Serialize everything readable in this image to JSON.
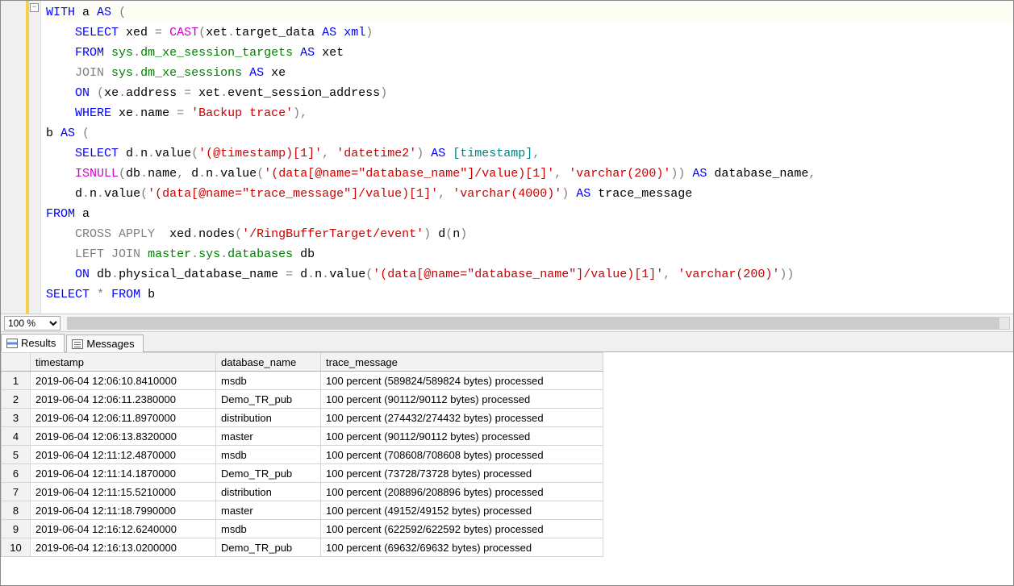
{
  "editor": {
    "fold_icon": "−",
    "code_lines": [
      [
        {
          "t": "WITH",
          "c": "kw-blue"
        },
        {
          "t": " a ",
          "c": "plain"
        },
        {
          "t": "AS",
          "c": "kw-blue"
        },
        {
          "t": " ",
          "c": "plain"
        },
        {
          "t": "(",
          "c": "kw-gray"
        }
      ],
      [
        {
          "t": "    ",
          "c": "plain"
        },
        {
          "t": "SELECT",
          "c": "kw-blue"
        },
        {
          "t": " xed ",
          "c": "plain"
        },
        {
          "t": "=",
          "c": "kw-gray"
        },
        {
          "t": " ",
          "c": "plain"
        },
        {
          "t": "CAST",
          "c": "kw-mag"
        },
        {
          "t": "(",
          "c": "kw-gray"
        },
        {
          "t": "xet",
          "c": "plain"
        },
        {
          "t": ".",
          "c": "kw-gray"
        },
        {
          "t": "target_data ",
          "c": "plain"
        },
        {
          "t": "AS",
          "c": "kw-blue"
        },
        {
          "t": " ",
          "c": "plain"
        },
        {
          "t": "xml",
          "c": "kw-blue"
        },
        {
          "t": ")",
          "c": "kw-gray"
        }
      ],
      [
        {
          "t": "    ",
          "c": "plain"
        },
        {
          "t": "FROM",
          "c": "kw-blue"
        },
        {
          "t": " ",
          "c": "plain"
        },
        {
          "t": "sys",
          "c": "kw-green"
        },
        {
          "t": ".",
          "c": "kw-gray"
        },
        {
          "t": "dm_xe_session_targets",
          "c": "kw-green"
        },
        {
          "t": " ",
          "c": "plain"
        },
        {
          "t": "AS",
          "c": "kw-blue"
        },
        {
          "t": " xet",
          "c": "plain"
        }
      ],
      [
        {
          "t": "    ",
          "c": "plain"
        },
        {
          "t": "JOIN",
          "c": "kw-gray"
        },
        {
          "t": " ",
          "c": "plain"
        },
        {
          "t": "sys",
          "c": "kw-green"
        },
        {
          "t": ".",
          "c": "kw-gray"
        },
        {
          "t": "dm_xe_sessions",
          "c": "kw-green"
        },
        {
          "t": " ",
          "c": "plain"
        },
        {
          "t": "AS",
          "c": "kw-blue"
        },
        {
          "t": " xe",
          "c": "plain"
        }
      ],
      [
        {
          "t": "    ",
          "c": "plain"
        },
        {
          "t": "ON",
          "c": "kw-blue"
        },
        {
          "t": " ",
          "c": "plain"
        },
        {
          "t": "(",
          "c": "kw-gray"
        },
        {
          "t": "xe",
          "c": "plain"
        },
        {
          "t": ".",
          "c": "kw-gray"
        },
        {
          "t": "address ",
          "c": "plain"
        },
        {
          "t": "=",
          "c": "kw-gray"
        },
        {
          "t": " xet",
          "c": "plain"
        },
        {
          "t": ".",
          "c": "kw-gray"
        },
        {
          "t": "event_session_address",
          "c": "plain"
        },
        {
          "t": ")",
          "c": "kw-gray"
        }
      ],
      [
        {
          "t": "    ",
          "c": "plain"
        },
        {
          "t": "WHERE",
          "c": "kw-blue"
        },
        {
          "t": " xe",
          "c": "plain"
        },
        {
          "t": ".",
          "c": "kw-gray"
        },
        {
          "t": "name ",
          "c": "plain"
        },
        {
          "t": "=",
          "c": "kw-gray"
        },
        {
          "t": " ",
          "c": "plain"
        },
        {
          "t": "'Backup trace'",
          "c": "kw-str"
        },
        {
          "t": "),",
          "c": "kw-gray"
        }
      ],
      [
        {
          "t": "b ",
          "c": "plain"
        },
        {
          "t": "AS",
          "c": "kw-blue"
        },
        {
          "t": " ",
          "c": "plain"
        },
        {
          "t": "(",
          "c": "kw-gray"
        }
      ],
      [
        {
          "t": "    ",
          "c": "plain"
        },
        {
          "t": "SELECT",
          "c": "kw-blue"
        },
        {
          "t": " d",
          "c": "plain"
        },
        {
          "t": ".",
          "c": "kw-gray"
        },
        {
          "t": "n",
          "c": "plain"
        },
        {
          "t": ".",
          "c": "kw-gray"
        },
        {
          "t": "value",
          "c": "plain"
        },
        {
          "t": "(",
          "c": "kw-gray"
        },
        {
          "t": "'(@timestamp)[1]'",
          "c": "kw-str"
        },
        {
          "t": ",",
          "c": "kw-gray"
        },
        {
          "t": " ",
          "c": "plain"
        },
        {
          "t": "'datetime2'",
          "c": "kw-str"
        },
        {
          "t": ")",
          "c": "kw-gray"
        },
        {
          "t": " ",
          "c": "plain"
        },
        {
          "t": "AS",
          "c": "kw-blue"
        },
        {
          "t": " ",
          "c": "plain"
        },
        {
          "t": "[timestamp]",
          "c": "kw-teal"
        },
        {
          "t": ",",
          "c": "kw-gray"
        }
      ],
      [
        {
          "t": "    ",
          "c": "plain"
        },
        {
          "t": "ISNULL",
          "c": "kw-mag"
        },
        {
          "t": "(",
          "c": "kw-gray"
        },
        {
          "t": "db",
          "c": "plain"
        },
        {
          "t": ".",
          "c": "kw-gray"
        },
        {
          "t": "name",
          "c": "plain"
        },
        {
          "t": ",",
          "c": "kw-gray"
        },
        {
          "t": " d",
          "c": "plain"
        },
        {
          "t": ".",
          "c": "kw-gray"
        },
        {
          "t": "n",
          "c": "plain"
        },
        {
          "t": ".",
          "c": "kw-gray"
        },
        {
          "t": "value",
          "c": "plain"
        },
        {
          "t": "(",
          "c": "kw-gray"
        },
        {
          "t": "'(data[@name=\"database_name\"]/value)[1]'",
          "c": "kw-str"
        },
        {
          "t": ",",
          "c": "kw-gray"
        },
        {
          "t": " ",
          "c": "plain"
        },
        {
          "t": "'varchar(200)'",
          "c": "kw-str"
        },
        {
          "t": "))",
          "c": "kw-gray"
        },
        {
          "t": " ",
          "c": "plain"
        },
        {
          "t": "AS",
          "c": "kw-blue"
        },
        {
          "t": " database_name",
          "c": "plain"
        },
        {
          "t": ",",
          "c": "kw-gray"
        }
      ],
      [
        {
          "t": "    d",
          "c": "plain"
        },
        {
          "t": ".",
          "c": "kw-gray"
        },
        {
          "t": "n",
          "c": "plain"
        },
        {
          "t": ".",
          "c": "kw-gray"
        },
        {
          "t": "value",
          "c": "plain"
        },
        {
          "t": "(",
          "c": "kw-gray"
        },
        {
          "t": "'(data[@name=\"trace_message\"]/value)[1]'",
          "c": "kw-str"
        },
        {
          "t": ",",
          "c": "kw-gray"
        },
        {
          "t": " ",
          "c": "plain"
        },
        {
          "t": "'varchar(4000)'",
          "c": "kw-str"
        },
        {
          "t": ")",
          "c": "kw-gray"
        },
        {
          "t": " ",
          "c": "plain"
        },
        {
          "t": "AS",
          "c": "kw-blue"
        },
        {
          "t": " trace_message",
          "c": "plain"
        }
      ],
      [
        {
          "t": "FROM",
          "c": "kw-blue"
        },
        {
          "t": " a",
          "c": "plain"
        }
      ],
      [
        {
          "t": "    ",
          "c": "plain"
        },
        {
          "t": "CROSS",
          "c": "kw-gray"
        },
        {
          "t": " ",
          "c": "plain"
        },
        {
          "t": "APPLY",
          "c": "kw-gray"
        },
        {
          "t": "  xed",
          "c": "plain"
        },
        {
          "t": ".",
          "c": "kw-gray"
        },
        {
          "t": "nodes",
          "c": "plain"
        },
        {
          "t": "(",
          "c": "kw-gray"
        },
        {
          "t": "'/RingBufferTarget/event'",
          "c": "kw-str"
        },
        {
          "t": ")",
          "c": "kw-gray"
        },
        {
          "t": " d",
          "c": "plain"
        },
        {
          "t": "(",
          "c": "kw-gray"
        },
        {
          "t": "n",
          "c": "plain"
        },
        {
          "t": ")",
          "c": "kw-gray"
        }
      ],
      [
        {
          "t": "    ",
          "c": "plain"
        },
        {
          "t": "LEFT",
          "c": "kw-gray"
        },
        {
          "t": " ",
          "c": "plain"
        },
        {
          "t": "JOIN",
          "c": "kw-gray"
        },
        {
          "t": " ",
          "c": "plain"
        },
        {
          "t": "master",
          "c": "kw-green"
        },
        {
          "t": ".",
          "c": "kw-gray"
        },
        {
          "t": "sys",
          "c": "kw-green"
        },
        {
          "t": ".",
          "c": "kw-gray"
        },
        {
          "t": "databases",
          "c": "kw-green"
        },
        {
          "t": " db",
          "c": "plain"
        }
      ],
      [
        {
          "t": "    ",
          "c": "plain"
        },
        {
          "t": "ON",
          "c": "kw-blue"
        },
        {
          "t": " db",
          "c": "plain"
        },
        {
          "t": ".",
          "c": "kw-gray"
        },
        {
          "t": "physical_database_name ",
          "c": "plain"
        },
        {
          "t": "=",
          "c": "kw-gray"
        },
        {
          "t": " d",
          "c": "plain"
        },
        {
          "t": ".",
          "c": "kw-gray"
        },
        {
          "t": "n",
          "c": "plain"
        },
        {
          "t": ".",
          "c": "kw-gray"
        },
        {
          "t": "value",
          "c": "plain"
        },
        {
          "t": "(",
          "c": "kw-gray"
        },
        {
          "t": "'(data[@name=\"database_name\"]/value)[1]'",
          "c": "kw-str"
        },
        {
          "t": ",",
          "c": "kw-gray"
        },
        {
          "t": " ",
          "c": "plain"
        },
        {
          "t": "'varchar(200)'",
          "c": "kw-str"
        },
        {
          "t": "))",
          "c": "kw-gray"
        }
      ],
      [
        {
          "t": "SELECT",
          "c": "kw-blue"
        },
        {
          "t": " ",
          "c": "plain"
        },
        {
          "t": "*",
          "c": "kw-gray"
        },
        {
          "t": " ",
          "c": "plain"
        },
        {
          "t": "FROM",
          "c": "kw-blue"
        },
        {
          "t": " b",
          "c": "plain"
        }
      ]
    ]
  },
  "zoom": {
    "value": "100 %"
  },
  "tabs": {
    "results": "Results",
    "messages": "Messages"
  },
  "results": {
    "columns": [
      "timestamp",
      "database_name",
      "trace_message"
    ],
    "rows": [
      [
        "2019-06-04 12:06:10.8410000",
        "msdb",
        "100 percent (589824/589824 bytes) processed"
      ],
      [
        "2019-06-04 12:06:11.2380000",
        "Demo_TR_pub",
        "100 percent (90112/90112 bytes) processed"
      ],
      [
        "2019-06-04 12:06:11.8970000",
        "distribution",
        "100 percent (274432/274432 bytes) processed"
      ],
      [
        "2019-06-04 12:06:13.8320000",
        "master",
        "100 percent (90112/90112 bytes) processed"
      ],
      [
        "2019-06-04 12:11:12.4870000",
        "msdb",
        "100 percent (708608/708608 bytes) processed"
      ],
      [
        "2019-06-04 12:11:14.1870000",
        "Demo_TR_pub",
        "100 percent (73728/73728 bytes) processed"
      ],
      [
        "2019-06-04 12:11:15.5210000",
        "distribution",
        "100 percent (208896/208896 bytes) processed"
      ],
      [
        "2019-06-04 12:11:18.7990000",
        "master",
        "100 percent (49152/49152 bytes) processed"
      ],
      [
        "2019-06-04 12:16:12.6240000",
        "msdb",
        "100 percent (622592/622592 bytes) processed"
      ],
      [
        "2019-06-04 12:16:13.0200000",
        "Demo_TR_pub",
        "100 percent (69632/69632 bytes) processed"
      ]
    ]
  }
}
